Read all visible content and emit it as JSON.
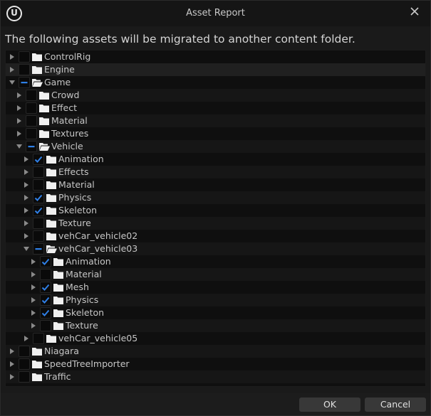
{
  "window": {
    "title": "Asset Report",
    "description": "The following assets will be migrated to another content folder."
  },
  "tree": [
    {
      "label": "ControlRig",
      "depth": 0,
      "expanded": false,
      "check": "unchecked"
    },
    {
      "label": "Engine",
      "depth": 0,
      "expanded": false,
      "check": "unchecked"
    },
    {
      "label": "Game",
      "depth": 0,
      "expanded": true,
      "check": "partial"
    },
    {
      "label": "Crowd",
      "depth": 1,
      "expanded": false,
      "check": "unchecked"
    },
    {
      "label": "Effect",
      "depth": 1,
      "expanded": false,
      "check": "unchecked"
    },
    {
      "label": "Material",
      "depth": 1,
      "expanded": false,
      "check": "unchecked"
    },
    {
      "label": "Textures",
      "depth": 1,
      "expanded": false,
      "check": "unchecked"
    },
    {
      "label": "Vehicle",
      "depth": 1,
      "expanded": true,
      "check": "partial"
    },
    {
      "label": "Animation",
      "depth": 2,
      "expanded": false,
      "check": "checked"
    },
    {
      "label": "Effects",
      "depth": 2,
      "expanded": false,
      "check": "unchecked"
    },
    {
      "label": "Material",
      "depth": 2,
      "expanded": false,
      "check": "unchecked"
    },
    {
      "label": "Physics",
      "depth": 2,
      "expanded": false,
      "check": "checked"
    },
    {
      "label": "Skeleton",
      "depth": 2,
      "expanded": false,
      "check": "checked"
    },
    {
      "label": "Texture",
      "depth": 2,
      "expanded": false,
      "check": "unchecked"
    },
    {
      "label": "vehCar_vehicle02",
      "depth": 2,
      "expanded": false,
      "check": "unchecked"
    },
    {
      "label": "vehCar_vehicle03",
      "depth": 2,
      "expanded": true,
      "check": "partial"
    },
    {
      "label": "Animation",
      "depth": 3,
      "expanded": false,
      "check": "checked"
    },
    {
      "label": "Material",
      "depth": 3,
      "expanded": false,
      "check": "unchecked"
    },
    {
      "label": "Mesh",
      "depth": 3,
      "expanded": false,
      "check": "checked"
    },
    {
      "label": "Physics",
      "depth": 3,
      "expanded": false,
      "check": "checked"
    },
    {
      "label": "Skeleton",
      "depth": 3,
      "expanded": false,
      "check": "checked"
    },
    {
      "label": "Texture",
      "depth": 3,
      "expanded": false,
      "check": "unchecked"
    },
    {
      "label": "vehCar_vehicle05",
      "depth": 2,
      "expanded": false,
      "check": "unchecked"
    },
    {
      "label": "Niagara",
      "depth": 0,
      "expanded": false,
      "check": "unchecked"
    },
    {
      "label": "SpeedTreeImporter",
      "depth": 0,
      "expanded": false,
      "check": "unchecked"
    },
    {
      "label": "Traffic",
      "depth": 0,
      "expanded": false,
      "check": "unchecked"
    }
  ],
  "footer": {
    "ok_label": "OK",
    "cancel_label": "Cancel"
  },
  "colors": {
    "accent": "#2f7fe6",
    "background": "#1a1a1a",
    "tree_background": "#0f0f0f",
    "button": "#383838"
  },
  "icons": {
    "logo": "unreal-engine-logo",
    "close": "close-icon",
    "folder": "folder-icon",
    "folder_open": "folder-open-icon",
    "expand": "expand-arrow-icon",
    "collapse": "collapse-arrow-icon"
  }
}
